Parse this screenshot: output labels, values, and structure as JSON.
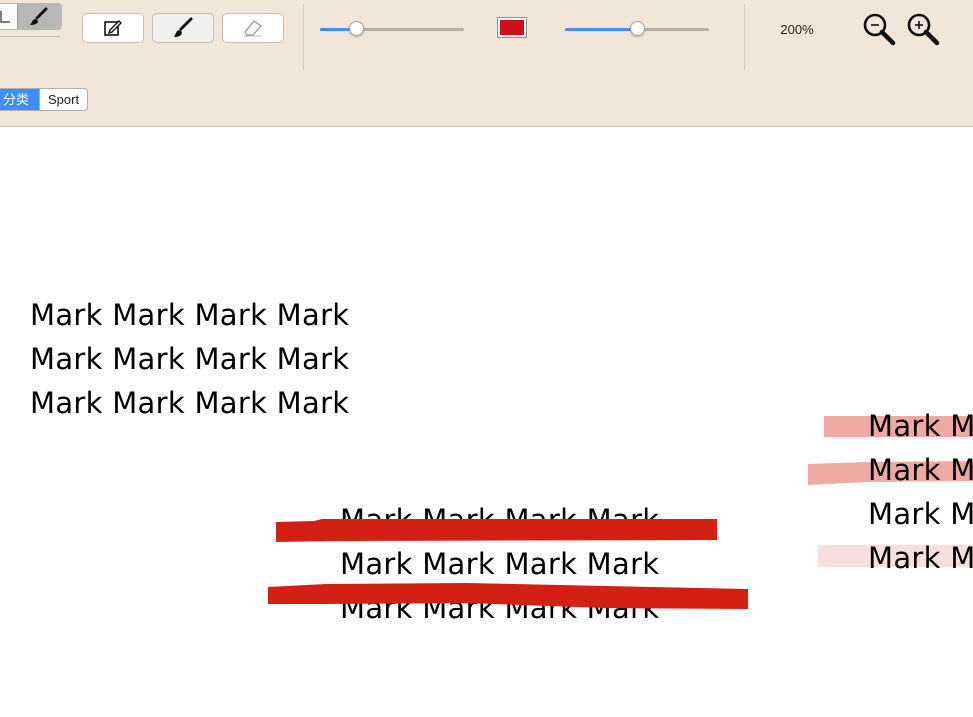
{
  "toolbar": {
    "tools": [
      {
        "name": "annotate-tool",
        "icon": "edit-icon",
        "active": false
      },
      {
        "name": "brush-tool",
        "icon": "brush-icon",
        "active": true
      },
      {
        "name": "eraser-tool",
        "icon": "eraser-icon",
        "active": false
      }
    ],
    "size_slider": {
      "fraction": 0.26
    },
    "color_swatch": {
      "color": "#d0101a"
    },
    "opacity_slider": {
      "fraction": 0.51
    },
    "zoom_level": "200%",
    "zoom_out_icon": "zoom-out-icon",
    "zoom_in_icon": "zoom-in-icon"
  },
  "tags": {
    "selected": "分类",
    "items": [
      "Sport"
    ]
  },
  "document": {
    "text_block_1": [
      "Mark Mark Mark Mark",
      "Mark Mark Mark Mark",
      "Mark Mark Mark Mark"
    ],
    "text_block_2": [
      "Mark Mark Mark Mark",
      "Mark Mark Mark Mark",
      "Mark Mark Mark Mark"
    ],
    "text_block_3": [
      "Mark M",
      "Mark M",
      "Mark M",
      "Mark M"
    ]
  },
  "colors": {
    "accent": "#3d8ff6",
    "stroke_red": "#d41f15",
    "highlight_pink": "#eea9a5",
    "highlight_faint": "#f6dfdc"
  }
}
